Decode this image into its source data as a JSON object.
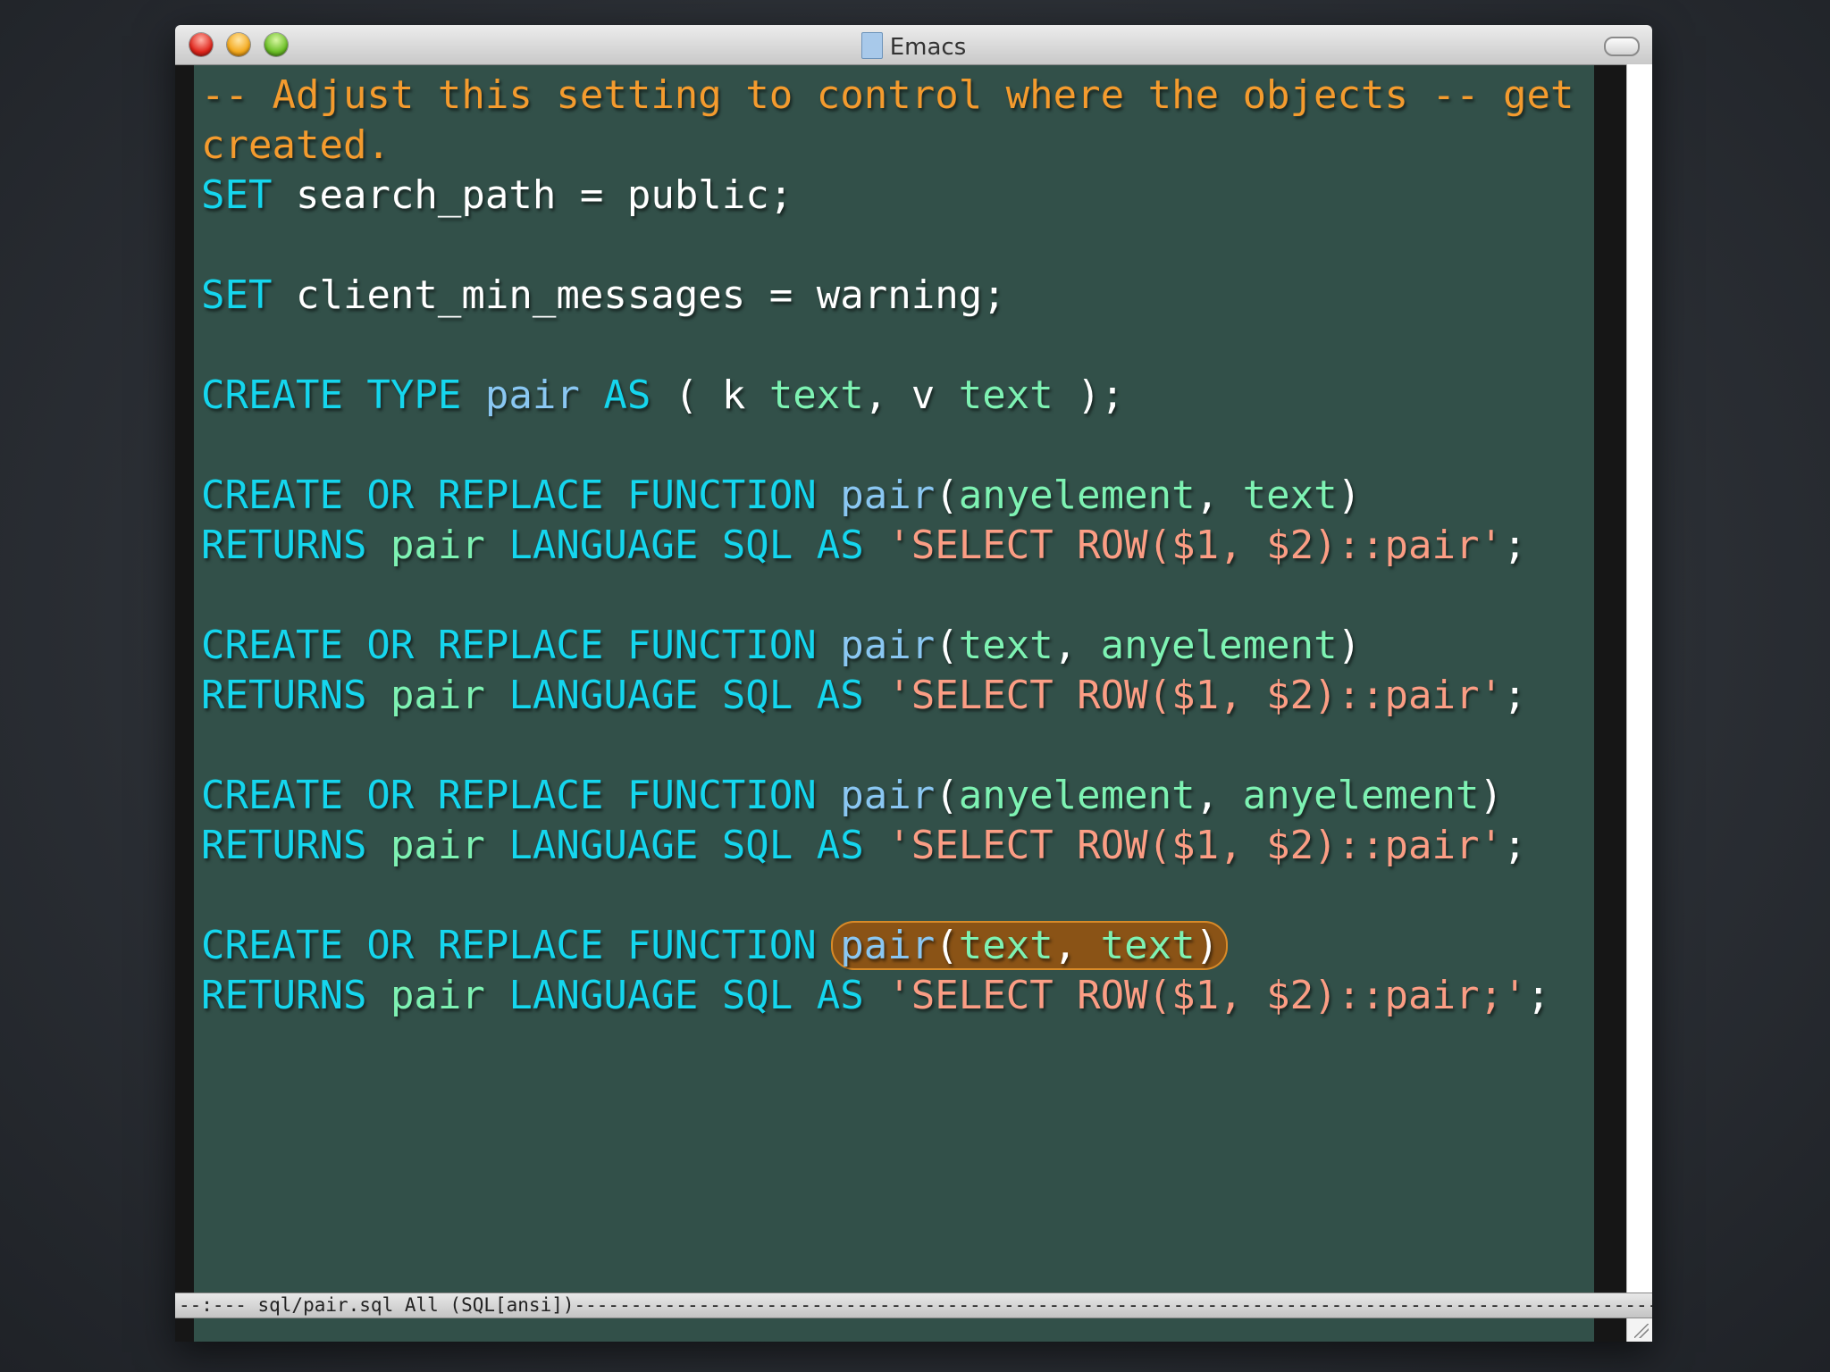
{
  "window": {
    "title": "Emacs"
  },
  "editor": {
    "lines": [
      [
        {
          "c": "cm",
          "t": "-- Adjust this setting to control where the objects -- get"
        }
      ],
      [
        {
          "c": "cm",
          "t": "created."
        }
      ],
      [
        {
          "c": "kw",
          "t": "SET"
        },
        {
          "t": " search_path = public;"
        }
      ],
      [],
      [
        {
          "c": "kw",
          "t": "SET"
        },
        {
          "t": " client_min_messages = warning;"
        }
      ],
      [],
      [
        {
          "c": "kw",
          "t": "CREATE TYPE"
        },
        {
          "t": " "
        },
        {
          "c": "fn",
          "t": "pair"
        },
        {
          "t": " "
        },
        {
          "c": "kw",
          "t": "AS"
        },
        {
          "t": " ( k "
        },
        {
          "c": "ty",
          "t": "text"
        },
        {
          "t": ", v "
        },
        {
          "c": "ty",
          "t": "text"
        },
        {
          "t": " );"
        }
      ],
      [],
      [
        {
          "c": "kw",
          "t": "CREATE OR REPLACE FUNCTION"
        },
        {
          "t": " "
        },
        {
          "c": "fn",
          "t": "pair"
        },
        {
          "t": "("
        },
        {
          "c": "ty",
          "t": "anyelement"
        },
        {
          "t": ", "
        },
        {
          "c": "ty",
          "t": "text"
        },
        {
          "t": ")"
        }
      ],
      [
        {
          "c": "kw",
          "t": "RETURNS"
        },
        {
          "t": " "
        },
        {
          "c": "ty",
          "t": "pair"
        },
        {
          "t": " "
        },
        {
          "c": "kw",
          "t": "LANGUAGE SQL AS"
        },
        {
          "t": " "
        },
        {
          "c": "st",
          "t": "'SELECT ROW($1, $2)::pair'"
        },
        {
          "t": ";"
        }
      ],
      [],
      [
        {
          "c": "kw",
          "t": "CREATE OR REPLACE FUNCTION"
        },
        {
          "t": " "
        },
        {
          "c": "fn",
          "t": "pair"
        },
        {
          "t": "("
        },
        {
          "c": "ty",
          "t": "text"
        },
        {
          "t": ", "
        },
        {
          "c": "ty",
          "t": "anyelement"
        },
        {
          "t": ")"
        }
      ],
      [
        {
          "c": "kw",
          "t": "RETURNS"
        },
        {
          "t": " "
        },
        {
          "c": "ty",
          "t": "pair"
        },
        {
          "t": " "
        },
        {
          "c": "kw",
          "t": "LANGUAGE SQL AS"
        },
        {
          "t": " "
        },
        {
          "c": "st",
          "t": "'SELECT ROW($1, $2)::pair'"
        },
        {
          "t": ";"
        }
      ],
      [],
      [
        {
          "c": "kw",
          "t": "CREATE OR REPLACE FUNCTION"
        },
        {
          "t": " "
        },
        {
          "c": "fn",
          "t": "pair"
        },
        {
          "t": "("
        },
        {
          "c": "ty",
          "t": "anyelement"
        },
        {
          "t": ", "
        },
        {
          "c": "ty",
          "t": "anyelement"
        },
        {
          "t": ")"
        }
      ],
      [
        {
          "c": "kw",
          "t": "RETURNS"
        },
        {
          "t": " "
        },
        {
          "c": "ty",
          "t": "pair"
        },
        {
          "t": " "
        },
        {
          "c": "kw",
          "t": "LANGUAGE SQL AS"
        },
        {
          "t": " "
        },
        {
          "c": "st",
          "t": "'SELECT ROW($1, $2)::pair'"
        },
        {
          "t": ";"
        }
      ],
      [],
      [
        {
          "c": "kw",
          "t": "CREATE OR REPLACE FUNCTION"
        },
        {
          "t": " "
        },
        {
          "hl": [
            {
              "c": "fn",
              "t": "pair"
            },
            {
              "t": "("
            },
            {
              "c": "ty",
              "t": "text"
            },
            {
              "t": ", "
            },
            {
              "c": "ty",
              "t": "text"
            },
            {
              "t": ")"
            }
          ]
        }
      ],
      [
        {
          "c": "kw",
          "t": "RETURNS"
        },
        {
          "t": " "
        },
        {
          "c": "ty",
          "t": "pair"
        },
        {
          "t": " "
        },
        {
          "c": "kw",
          "t": "LANGUAGE SQL AS"
        },
        {
          "t": " "
        },
        {
          "c": "st",
          "t": "'SELECT ROW($1, $2)::pair;'"
        },
        {
          "t": ";"
        }
      ]
    ]
  },
  "modeline": {
    "text": "--:--- sql/pair.sql     All  (SQL[ansi])-----------------------------------------------------------------------------------------------------"
  },
  "colors": {
    "editor_background": "#325049",
    "comment": "#f49b2e",
    "keyword": "#15d6ee",
    "type": "#7ef2b3",
    "function_name": "#8ac7f2",
    "string": "#fb9d84",
    "highlight": "#8a5316"
  },
  "icons": {
    "close": "close-icon",
    "minimize": "minimize-icon",
    "zoom": "zoom-icon",
    "document": "document-icon",
    "toolbar_toggle": "toolbar-toggle-icon",
    "resize": "resize-grip-icon"
  }
}
